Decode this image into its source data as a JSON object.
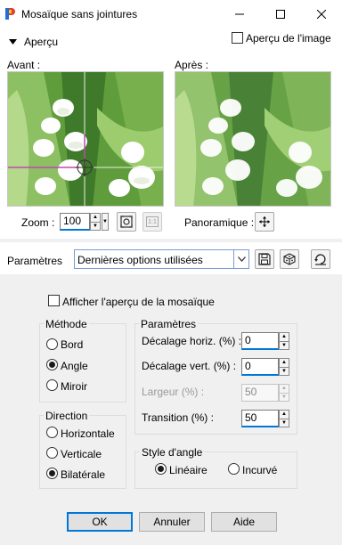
{
  "window": {
    "title": "Mosaïque sans jointures"
  },
  "preview_section": {
    "toggle_label": "Aperçu",
    "image_preview_checkbox_label": "Aperçu de l'image",
    "image_preview_checked": false,
    "before_label": "Avant :",
    "after_label": "Après :",
    "zoom_label": "Zoom :",
    "zoom_value": "100",
    "panoramique_label": "Panoramique :",
    "actual_size_label": "1:1"
  },
  "presets": {
    "label": "Paramètres",
    "selected": "Dernières options utilisées"
  },
  "options": {
    "show_tile_preview_label": "Afficher l'aperçu de la mosaïque",
    "show_tile_preview_checked": false,
    "method": {
      "title": "Méthode",
      "items": [
        "Bord",
        "Angle",
        "Miroir"
      ],
      "selected": "Angle"
    },
    "direction": {
      "title": "Direction",
      "items": [
        "Horizontale",
        "Verticale",
        "Bilatérale"
      ],
      "selected": "Bilatérale"
    },
    "params": {
      "title": "Paramètres",
      "h_offset_label": "Décalage horiz. (%) :",
      "h_offset_value": "0",
      "v_offset_label": "Décalage vert. (%) :",
      "v_offset_value": "0",
      "width_label": "Largeur (%) :",
      "width_value": "50",
      "transition_label": "Transition (%) :",
      "transition_value": "50"
    },
    "corner_style": {
      "title": "Style d'angle",
      "items": [
        "Linéaire",
        "Incurvé"
      ],
      "selected": "Linéaire"
    }
  },
  "buttons": {
    "ok": "OK",
    "cancel": "Annuler",
    "help": "Aide"
  }
}
